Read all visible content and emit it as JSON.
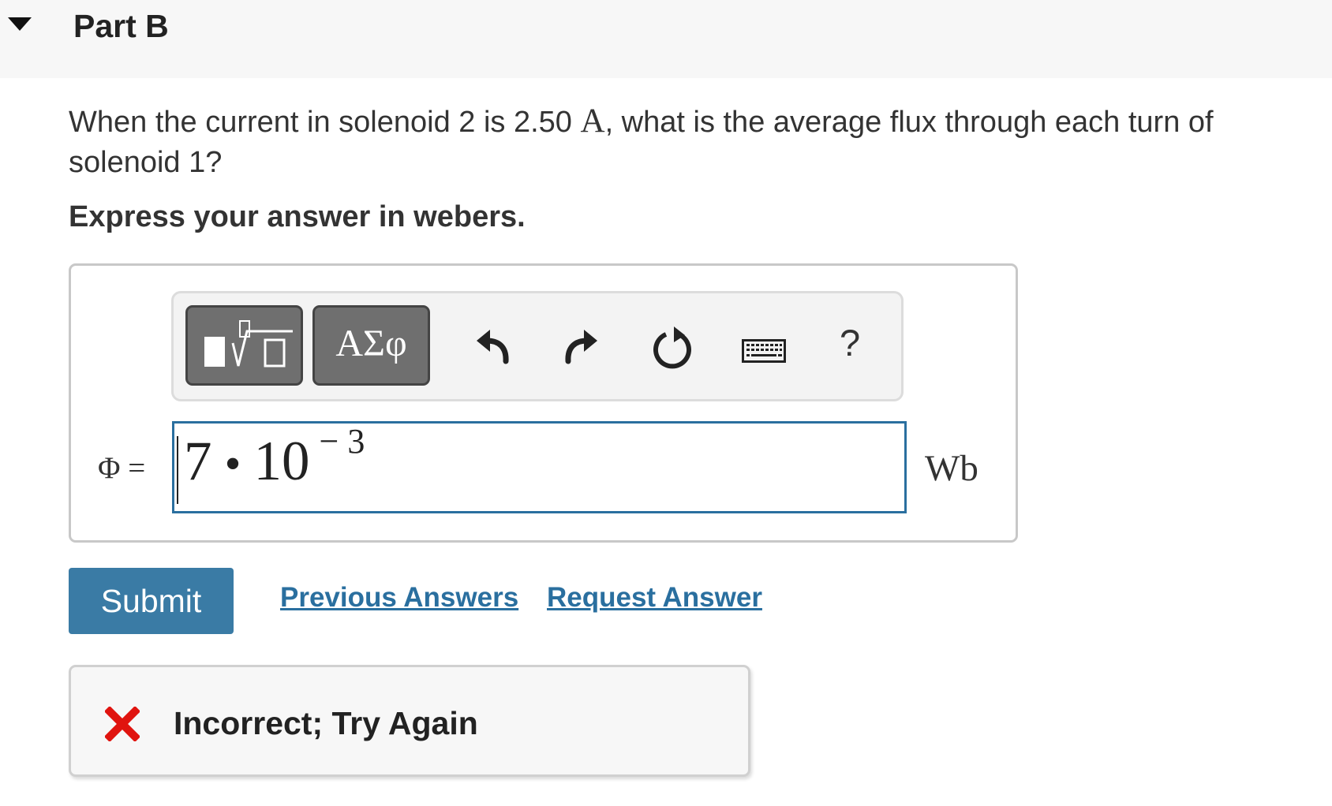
{
  "part": {
    "title": "Part B",
    "toggle_icon": "triangle-down-icon"
  },
  "question": {
    "text_before": "When the current in solenoid 2 is 2.50 ",
    "unit": "A",
    "text_after": ", what is the average flux through each turn of solenoid 1?",
    "instruction": "Express your answer in webers."
  },
  "toolbar": {
    "templates_icon": "math-templates-icon",
    "symbols_label": "ΑΣφ",
    "undo_icon": "undo-icon",
    "redo_icon": "redo-icon",
    "reset_icon": "reset-icon",
    "keyboard_icon": "keyboard-icon",
    "help_label": "?"
  },
  "answer": {
    "variable": "Φ =",
    "mantissa": "7",
    "operator": "•",
    "base": "10",
    "exponent": "− 3",
    "unit": "Wb",
    "input_border_color": "#2a6f9f"
  },
  "actions": {
    "submit_label": "Submit",
    "previous_answers_label": "Previous Answers",
    "request_answer_label": "Request Answer",
    "submit_color": "#3a7ba5",
    "link_color": "#2a6f9f"
  },
  "feedback": {
    "icon": "x-mark-icon",
    "icon_color": "#e0140f",
    "text": "Incorrect; Try Again"
  }
}
